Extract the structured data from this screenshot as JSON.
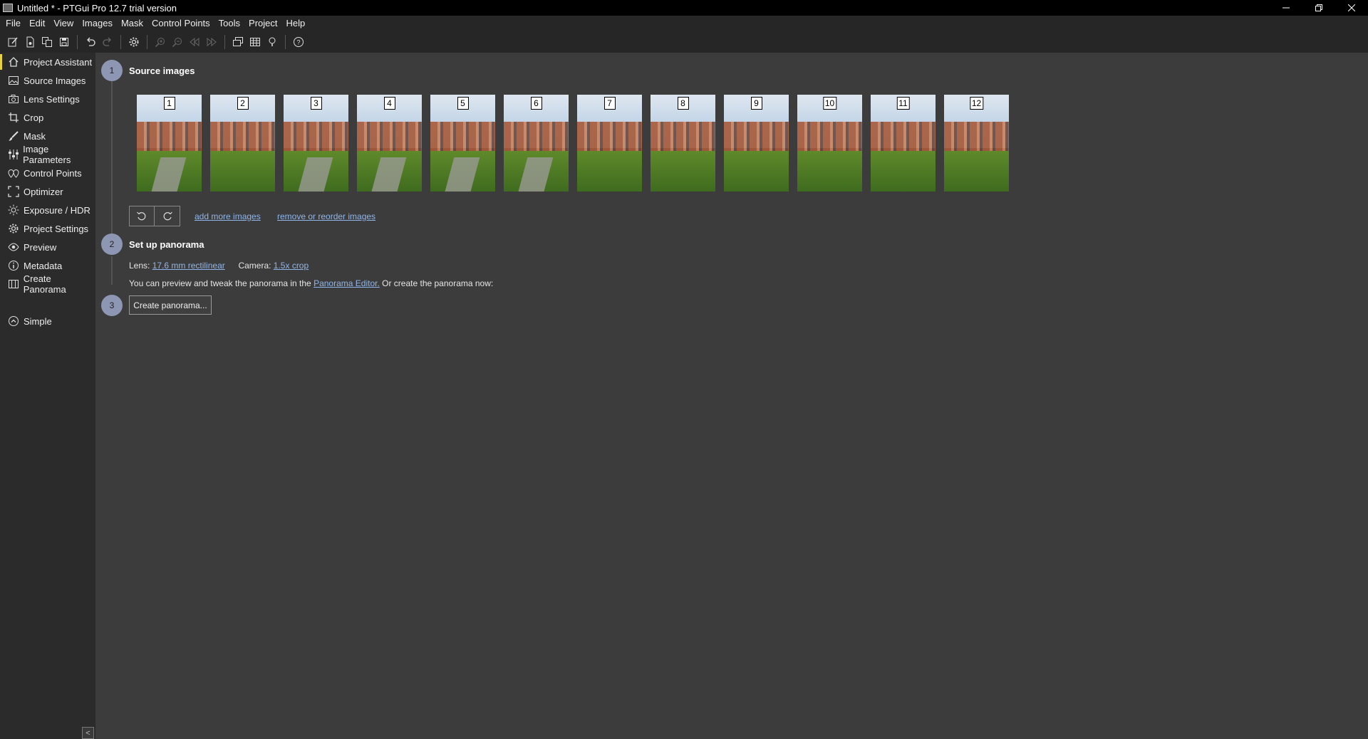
{
  "window": {
    "title": "Untitled * - PTGui Pro 12.7 trial version",
    "controls": [
      "minimize",
      "restore",
      "close"
    ]
  },
  "menu": [
    "File",
    "Edit",
    "View",
    "Images",
    "Mask",
    "Control Points",
    "Tools",
    "Project",
    "Help"
  ],
  "toolbar": {
    "icons": [
      "new-project-icon",
      "open-project-icon",
      "open-recent-icon",
      "save-icon",
      "undo-icon",
      "redo-icon",
      "settings-icon",
      "zoom-in-icon",
      "zoom-out-icon",
      "previous-icon",
      "next-icon",
      "panorama-editor-icon",
      "table-icon",
      "tip-icon",
      "help-icon"
    ]
  },
  "sidebar": {
    "items": [
      {
        "label": "Project Assistant",
        "icon": "home-icon",
        "active": true
      },
      {
        "label": "Source Images",
        "icon": "image-icon"
      },
      {
        "label": "Lens Settings",
        "icon": "camera-icon"
      },
      {
        "label": "Crop",
        "icon": "crop-icon"
      },
      {
        "label": "Mask",
        "icon": "brush-icon"
      },
      {
        "label": "Image Parameters",
        "icon": "sliders-icon"
      },
      {
        "label": "Control Points",
        "icon": "control-points-icon"
      },
      {
        "label": "Optimizer",
        "icon": "optimizer-icon"
      },
      {
        "label": "Exposure / HDR",
        "icon": "sun-icon"
      },
      {
        "label": "Project Settings",
        "icon": "gear-icon"
      },
      {
        "label": "Preview",
        "icon": "eye-icon"
      },
      {
        "label": "Metadata",
        "icon": "info-icon"
      },
      {
        "label": "Create Panorama",
        "icon": "panorama-icon"
      }
    ],
    "simple": {
      "label": "Simple",
      "icon": "chevron-up-circle-icon"
    },
    "collapse": "<"
  },
  "steps": {
    "source": {
      "number": "1",
      "title": "Source images"
    },
    "setup": {
      "number": "2",
      "title": "Set up panorama"
    },
    "create": {
      "number": "3",
      "button": "Create panorama..."
    }
  },
  "thumbnails": [
    "1",
    "2",
    "3",
    "4",
    "5",
    "6",
    "7",
    "8",
    "9",
    "10",
    "11",
    "12"
  ],
  "source_actions": {
    "add_more": "add more images",
    "remove_reorder": "remove or reorder images"
  },
  "setup": {
    "lens_label": "Lens:",
    "lens_value": "17.6 mm rectilinear",
    "camera_label": "Camera:",
    "camera_value": "1.5x crop",
    "preview_text": "You can preview and tweak the panorama in the",
    "editor_link": "Panorama Editor.",
    "create_text": "Or create the panorama now:"
  }
}
